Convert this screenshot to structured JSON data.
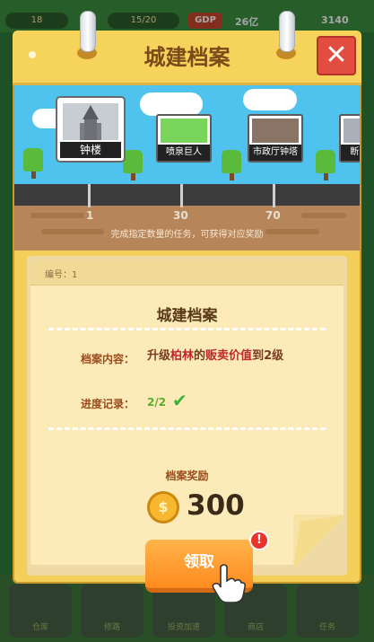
{
  "hud": {
    "pill1": "18",
    "pill2": "15/20",
    "gdp_label": "GDP",
    "gdp_value": "26亿",
    "money": "3140"
  },
  "dialog": {
    "title": "城建档案",
    "close_label": "✕"
  },
  "timeline": {
    "items": [
      {
        "label": "钟楼",
        "selected": true
      },
      {
        "label": "喷泉巨人",
        "selected": false
      },
      {
        "label": "市政厅钟塔",
        "selected": false
      },
      {
        "label": "断...",
        "selected": false
      }
    ],
    "ticks": [
      "1",
      "30",
      "70"
    ],
    "hint": "完成指定数量的任务，可获得对应奖励"
  },
  "archive": {
    "number_label": "编号：1",
    "title": "城建档案",
    "content_label": "档案内容：",
    "content_parts": [
      "升级",
      "柏林",
      "的",
      "贩卖价值",
      "到2级"
    ],
    "progress_label": "进度记录：",
    "progress_value": "2/2",
    "reward_label": "档案奖励",
    "reward_value": "300",
    "coin_symbol": "$",
    "claim_label": "领取",
    "badge": "!"
  },
  "bottom_nav": {
    "items": [
      "仓库",
      "修路",
      "投资加速",
      "商店",
      "任务"
    ]
  },
  "colors": {
    "panel": "#f4cf59",
    "title": "#7a4a18",
    "close": "#e24d3f",
    "claim": "#ff8a1f",
    "highlight": "#c0272d",
    "progress": "#57ad2b"
  }
}
